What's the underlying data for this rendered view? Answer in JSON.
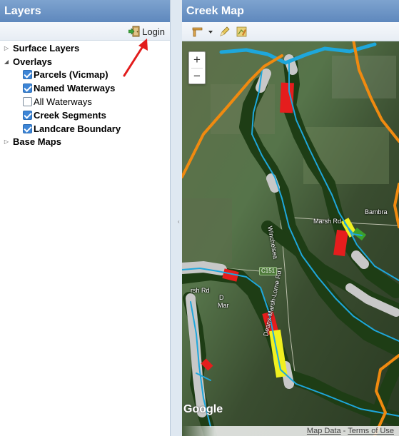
{
  "layers_panel": {
    "title": "Layers",
    "login_label": "Login",
    "tree": [
      {
        "label": "Surface Layers",
        "expanded": false
      },
      {
        "label": "Overlays",
        "expanded": true,
        "children": [
          {
            "label": "Parcels (Vicmap)",
            "checked": true
          },
          {
            "label": "Named Waterways",
            "checked": true
          },
          {
            "label": "All Waterways",
            "checked": false
          },
          {
            "label": "Creek Segments",
            "checked": true
          },
          {
            "label": "Landcare Boundary",
            "checked": true
          }
        ]
      },
      {
        "label": "Base Maps",
        "expanded": false
      }
    ]
  },
  "map_panel": {
    "title": "Creek Map",
    "toolbar": {
      "icons": [
        "measure-icon",
        "dropdown-arrow-icon",
        "pencil-icon",
        "layer-edit-icon"
      ]
    },
    "zoom": {
      "in_label": "+",
      "out_label": "−"
    },
    "labels": {
      "bambra": "Bambra",
      "marsh_rd_upper": "Marsh Rd",
      "marsh_rd_lower": "rsh Rd",
      "winchelsea": "Winchelsea",
      "deans_marsh_lorne": "Deans Marsh-Lorne Rd",
      "c151": "C151",
      "deans_marsh_partial_1": "D",
      "deans_marsh_partial_2": "Mar"
    },
    "logo": "Google",
    "attribution": {
      "map_data": "Map Data",
      "separator": " - ",
      "terms": "Terms of Use"
    },
    "colors": {
      "waterway": "#1ea7dc",
      "landcare_boundary": "#f08a10",
      "creek_segment_good": "#1e3d15",
      "creek_segment_poor": "#e51d1d",
      "creek_segment_moderate": "#f0f020",
      "creek_segment_unassessed": "#c8c8c8",
      "annotation_arrow": "#e21b1b"
    }
  }
}
